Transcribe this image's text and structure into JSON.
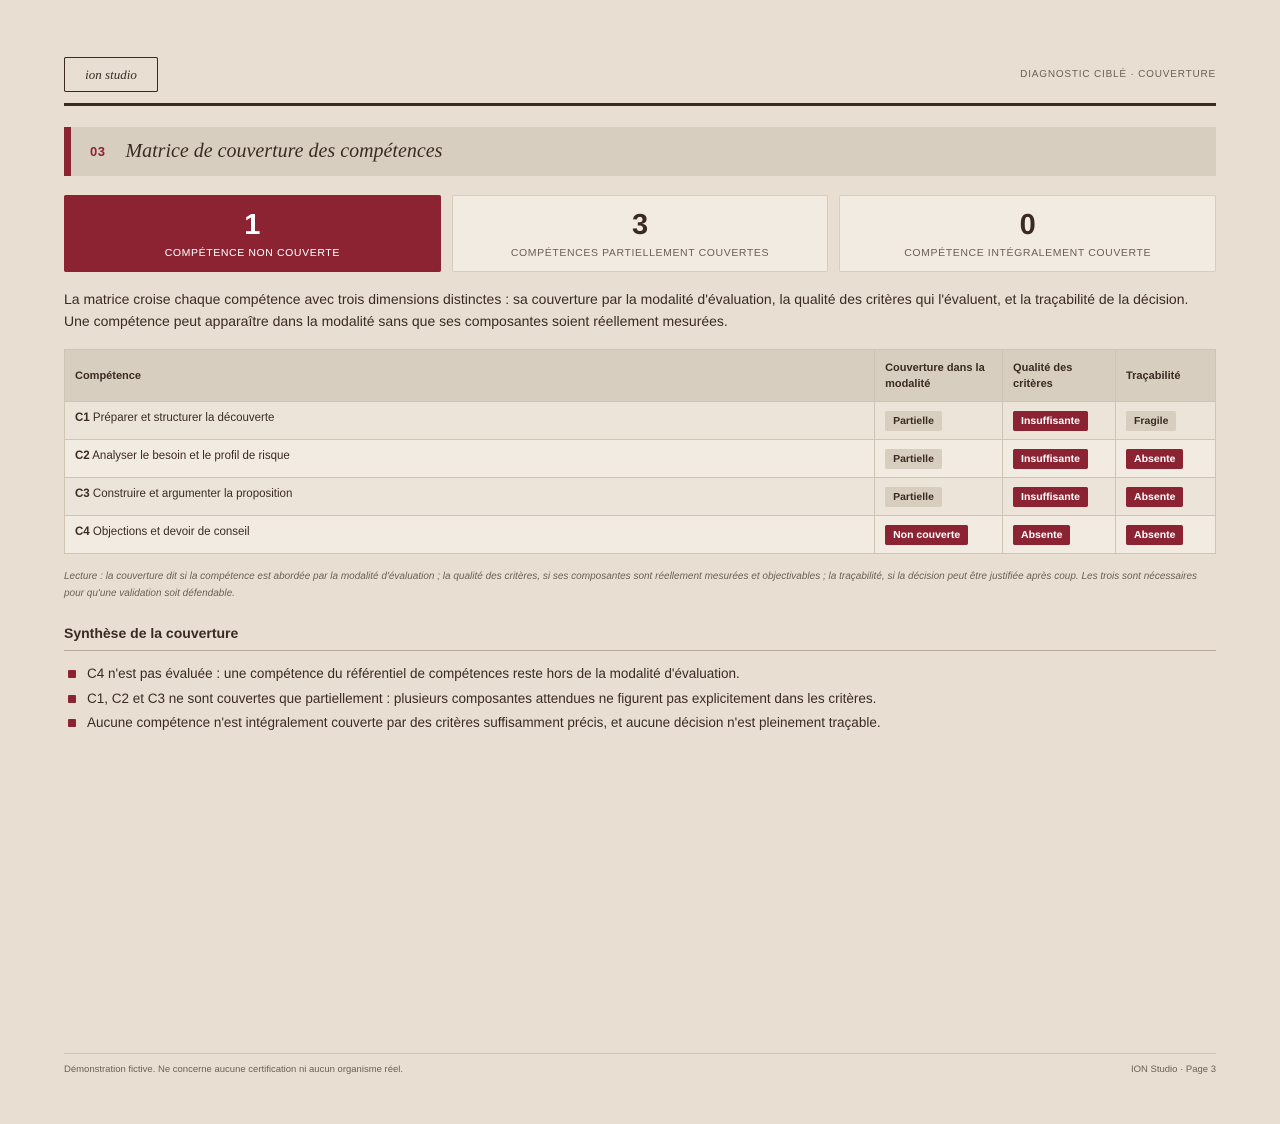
{
  "header": {
    "logo": "ion studio",
    "right_label": "DIAGNOSTIC CIBLÉ · COUVERTURE"
  },
  "section": {
    "number": "03",
    "title": "Matrice de couverture des compétences"
  },
  "stats": [
    {
      "value": "1",
      "label": "COMPÉTENCE NON COUVERTE"
    },
    {
      "value": "3",
      "label": "COMPÉTENCES PARTIELLEMENT COUVERTES"
    },
    {
      "value": "0",
      "label": "COMPÉTENCE INTÉGRALEMENT COUVERTE"
    }
  ],
  "intro": "La matrice croise chaque compétence avec trois dimensions distinctes : sa couverture par la modalité d'évaluation, la qualité des critères qui l'évaluent, et la traçabilité de la décision. Une compétence peut apparaître dans la modalité sans que ses composantes soient réellement mesurées.",
  "table": {
    "headers": [
      "Compétence",
      "Couverture dans la modalité",
      "Qualité des critères",
      "Traçabilité"
    ],
    "rows": [
      {
        "code": "C1",
        "name": "Préparer et structurer la découverte",
        "couverture": "Partielle",
        "qualite": "Insuffisante",
        "tracabilite": "Fragile"
      },
      {
        "code": "C2",
        "name": "Analyser le besoin et le profil de risque",
        "couverture": "Partielle",
        "qualite": "Insuffisante",
        "tracabilite": "Absente"
      },
      {
        "code": "C3",
        "name": "Construire et argumenter la proposition",
        "couverture": "Partielle",
        "qualite": "Insuffisante",
        "tracabilite": "Absente"
      },
      {
        "code": "C4",
        "name": "Objections et devoir de conseil",
        "couverture": "Non couverte",
        "qualite": "Absente",
        "tracabilite": "Absente"
      }
    ]
  },
  "note": "Lecture : la couverture dit si la compétence est abordée par la modalité d'évaluation ; la qualité des critères, si ses composantes sont réellement mesurées et objectivables ; la traçabilité, si la décision peut être justifiée après coup. Les trois sont nécessaires pour qu'une validation soit défendable.",
  "synthesis": {
    "title": "Synthèse de la couverture",
    "points": [
      "C4 n'est pas évaluée : une compétence du référentiel de compétences reste hors de la modalité d'évaluation.",
      "C1, C2 et C3 ne sont couvertes que partiellement : plusieurs composantes attendues ne figurent pas explicitement dans les critères.",
      "Aucune compétence n'est intégralement couverte par des critères suffisamment précis, et aucune décision n'est pleinement traçable."
    ]
  },
  "footer": {
    "left": "Démonstration fictive. Ne concerne aucune certification ni aucun organisme réel.",
    "right": "ION Studio · Page 3"
  },
  "colors": {
    "accent": "#8b2332",
    "background": "#e8dfd2",
    "panel": "#d8cebf",
    "text": "#3a2a22"
  }
}
